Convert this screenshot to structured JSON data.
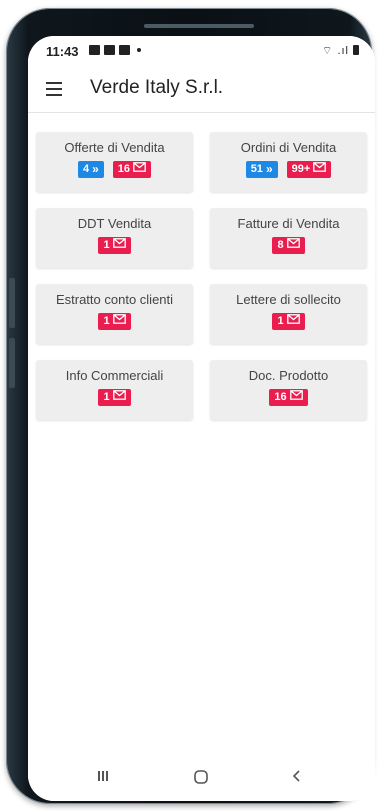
{
  "status_bar": {
    "time": "11:43",
    "signal": "⌔ .ıl"
  },
  "app_bar": {
    "title": "Verde Italy S.r.l."
  },
  "cards": [
    {
      "title": "Offerte di Vendita",
      "badges": [
        {
          "type": "blue",
          "count": "4",
          "icon": "double-chevron-icon"
        },
        {
          "type": "red",
          "count": "16",
          "icon": "mail-icon"
        }
      ]
    },
    {
      "title": "Ordini di Vendita",
      "badges": [
        {
          "type": "blue",
          "count": "51",
          "icon": "double-chevron-icon"
        },
        {
          "type": "red",
          "count": "99+",
          "icon": "mail-icon"
        }
      ]
    },
    {
      "title": "DDT Vendita",
      "badges": [
        {
          "type": "red",
          "count": "1",
          "icon": "mail-icon"
        }
      ]
    },
    {
      "title": "Fatture di Vendita",
      "badges": [
        {
          "type": "red",
          "count": "8",
          "icon": "mail-icon"
        }
      ]
    },
    {
      "title": "Estratto conto clienti",
      "badges": [
        {
          "type": "red",
          "count": "1",
          "icon": "mail-icon"
        }
      ]
    },
    {
      "title": "Lettere di sollecito",
      "badges": [
        {
          "type": "red",
          "count": "1",
          "icon": "mail-icon"
        }
      ]
    },
    {
      "title": "Info Commerciali",
      "badges": [
        {
          "type": "red",
          "count": "1",
          "icon": "mail-icon"
        }
      ]
    },
    {
      "title": "Doc. Prodotto",
      "badges": [
        {
          "type": "red",
          "count": "16",
          "icon": "mail-icon"
        }
      ]
    }
  ],
  "colors": {
    "badge_blue": "#1e88e5",
    "badge_red": "#e91e4f",
    "card_bg": "#eeeeee"
  }
}
